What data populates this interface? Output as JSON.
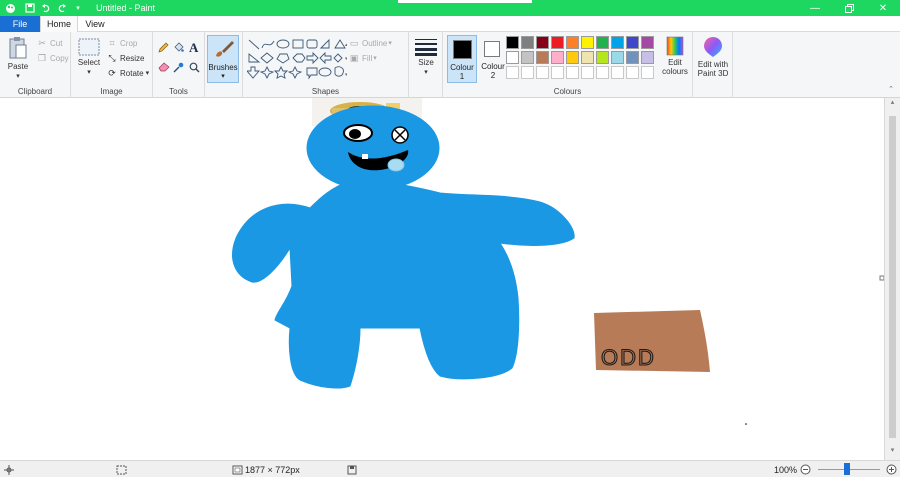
{
  "window": {
    "title": "Untitled - Paint",
    "titlebar_color": "#1ed760"
  },
  "tabs": {
    "file": "File",
    "home": "Home",
    "view": "View"
  },
  "ribbon": {
    "clipboard": {
      "paste": "Paste",
      "cut": "Cut",
      "copy": "Copy",
      "label": "Clipboard"
    },
    "image": {
      "select": "Select",
      "crop": "Crop",
      "resize": "Resize",
      "rotate": "Rotate",
      "label": "Image"
    },
    "tools": {
      "label": "Tools"
    },
    "brushes": {
      "label": "Brushes"
    },
    "shapes": {
      "outline": "Outline",
      "fill": "Fill",
      "label": "Shapes"
    },
    "size": {
      "label": "Size"
    },
    "colours": {
      "colour1": "Colour 1",
      "colour2": "Colour 2",
      "edit_colours": "Edit colours",
      "label": "Colours",
      "colour1_value": "#000000",
      "colour2_value": "#ffffff",
      "palette_row1": [
        "#000000",
        "#7f7f7f",
        "#880015",
        "#ed1c24",
        "#ff7f27",
        "#fff200",
        "#22b14c",
        "#00a2e8",
        "#3f48cc",
        "#a349a4"
      ],
      "palette_row2": [
        "#ffffff",
        "#c3c3c3",
        "#b97a57",
        "#ffaec9",
        "#ffc90e",
        "#efe4b0",
        "#b5e61d",
        "#99d9ea",
        "#7092be",
        "#c8bfe7"
      ],
      "palette_row3": [
        "#ffffff",
        "#ffffff",
        "#ffffff",
        "#ffffff",
        "#ffffff",
        "#ffffff",
        "#ffffff",
        "#ffffff",
        "#ffffff",
        "#ffffff"
      ]
    },
    "paint3d": {
      "label": "Edit with Paint 3D"
    }
  },
  "canvas": {
    "sign_text": "ODD",
    "character_color": "#1a98e3",
    "sign_color": "#b87b57"
  },
  "statusbar": {
    "dimensions": "1877 × 772px",
    "zoom": "100%"
  }
}
